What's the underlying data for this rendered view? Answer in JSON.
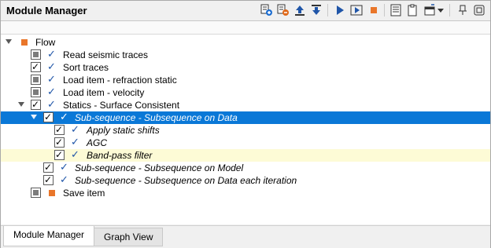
{
  "window": {
    "title": "Module Manager"
  },
  "toolbar": {
    "icons": [
      "add-module-icon",
      "remove-module-icon",
      "move-up-icon",
      "move-down-icon",
      "run-icon",
      "run-step-icon",
      "stop-icon",
      "log-icon",
      "clipboard-icon",
      "window-options-icon",
      "dropdown-icon",
      "pin-icon",
      "float-window-icon"
    ]
  },
  "tree": {
    "items": [
      {
        "label": "Flow",
        "italic": false
      },
      {
        "label": "Read seismic traces",
        "italic": false
      },
      {
        "label": "Sort traces",
        "italic": false
      },
      {
        "label": "Load item - refraction static",
        "italic": false
      },
      {
        "label": "Load item - velocity",
        "italic": false
      },
      {
        "label": "Statics - Surface Consistent",
        "italic": false
      },
      {
        "label": "Sub-sequence - Subsequence on Data",
        "italic": true
      },
      {
        "label": "Apply static shifts",
        "italic": true
      },
      {
        "label": "AGC",
        "italic": true
      },
      {
        "label": "Band-pass filter",
        "italic": true
      },
      {
        "label": "Sub-sequence - Subsequence on Model",
        "italic": true
      },
      {
        "label": "Sub-sequence - Subsequence on Data each iteration",
        "italic": true
      },
      {
        "label": "Save item",
        "italic": false
      }
    ]
  },
  "tabs": [
    {
      "label": "Module Manager",
      "active": true
    },
    {
      "label": "Graph View",
      "active": false
    }
  ],
  "colors": {
    "selection": "#0a78d7",
    "highlight": "#fdfbd6",
    "check": "#1f55a8",
    "module_square": "#e9762a"
  }
}
